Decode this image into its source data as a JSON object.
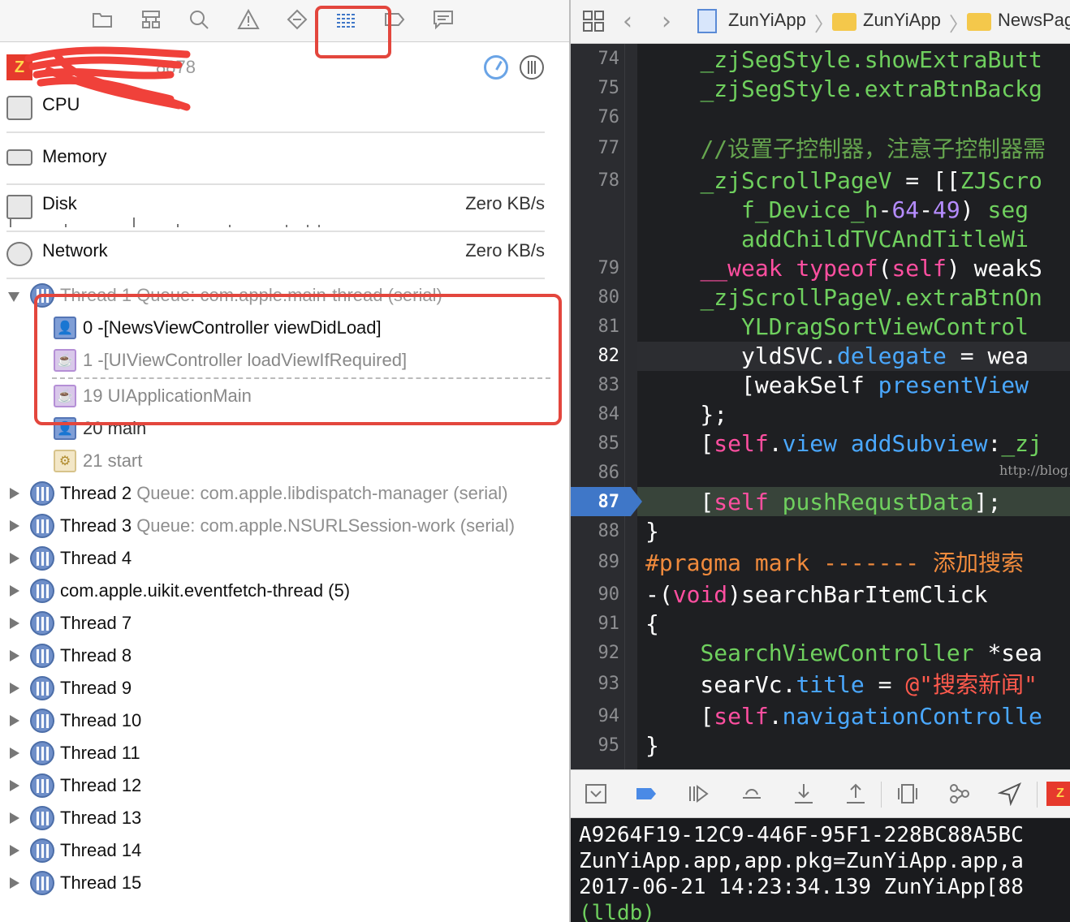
{
  "navigator_tabs": [
    "project-navigator",
    "symbol-navigator",
    "find-navigator",
    "issue-navigator",
    "test-navigator",
    "debug-navigator",
    "breakpoint-navigator",
    "report-navigator"
  ],
  "process": {
    "label": "8878"
  },
  "gauges": [
    {
      "name": "CPU",
      "value": ""
    },
    {
      "name": "Memory",
      "value": ""
    },
    {
      "name": "Disk",
      "value": "Zero KB/s"
    },
    {
      "name": "Network",
      "value": "Zero KB/s"
    }
  ],
  "thread1": {
    "name": "Thread 1",
    "queue": "Queue: com.apple.main-thread (serial)"
  },
  "frames": [
    {
      "text": "0 -[NewsViewController viewDidLoad]",
      "kind": "user"
    },
    {
      "text": "1 -[UIViewController loadViewIfRequired]",
      "kind": "system"
    },
    {
      "text": "19 UIApplicationMain",
      "kind": "system"
    },
    {
      "text": "20 main",
      "kind": "user"
    },
    {
      "text": "21 start",
      "kind": "start"
    }
  ],
  "threads": [
    {
      "name": "Thread 2",
      "queue": "Queue: com.apple.libdispatch-manager (serial)"
    },
    {
      "name": "Thread 3",
      "queue": "Queue: com.apple.NSURLSession-work (serial)"
    },
    {
      "name": "Thread 4",
      "queue": ""
    },
    {
      "name": "com.apple.uikit.eventfetch-thread (5)",
      "queue": ""
    },
    {
      "name": "Thread 7",
      "queue": ""
    },
    {
      "name": "Thread 8",
      "queue": ""
    },
    {
      "name": "Thread 9",
      "queue": ""
    },
    {
      "name": "Thread 10",
      "queue": ""
    },
    {
      "name": "Thread 11",
      "queue": ""
    },
    {
      "name": "Thread 12",
      "queue": ""
    },
    {
      "name": "Thread 13",
      "queue": ""
    },
    {
      "name": "Thread 14",
      "queue": ""
    },
    {
      "name": "Thread 15",
      "queue": ""
    }
  ],
  "jumpbar": {
    "crumbs": [
      "ZunYiApp",
      "ZunYiApp",
      "NewsPag"
    ]
  },
  "editor": {
    "line_numbers": [
      "74",
      "75",
      "76",
      "77",
      "78",
      "79",
      "80",
      "81",
      "82",
      "83",
      "84",
      "85",
      "86",
      "87",
      "88",
      "89",
      "90",
      "91",
      "92",
      "93",
      "94",
      "95"
    ],
    "current_line": "82",
    "breakpoint_line": "87"
  },
  "watermark": "http://blog.csdn.net/dxblzjy",
  "console": {
    "lines": [
      "A9264F19-12C9-446F-95F1-228BC88A5BC",
      "ZunYiApp.app,app.pkg=ZunYiApp.app,a",
      "2017-06-21 14:23:34.139 ZunYiApp[88"
    ],
    "prompt": "(lldb)"
  },
  "colors": {
    "highlight": "#e3463d",
    "breakpoint": "#3f77c8",
    "editor_bg": "#1e1f22"
  }
}
